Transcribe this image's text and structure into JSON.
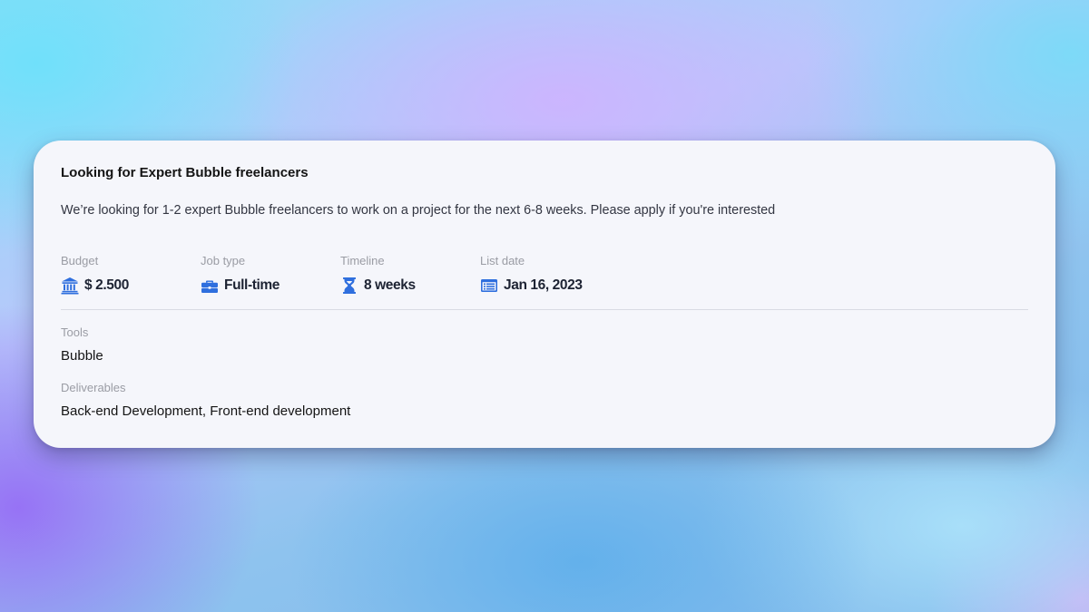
{
  "job": {
    "title": "Looking for Expert Bubble freelancers",
    "description": "We’re looking for 1-2 expert Bubble freelancers to work on a project for the next 6-8 weeks. Please apply if you're interested",
    "meta": {
      "budget": {
        "label": "Budget",
        "value": "$ 2.500",
        "icon": "bank-icon"
      },
      "job_type": {
        "label": "Job type",
        "value": "Full-time",
        "icon": "briefcase-icon"
      },
      "timeline": {
        "label": "Timeline",
        "value": "8 weeks",
        "icon": "hourglass-icon"
      },
      "list_date": {
        "label": "List date",
        "value": "Jan 16, 2023",
        "icon": "calendar-list-icon"
      }
    },
    "tools": {
      "label": "Tools",
      "value": "Bubble"
    },
    "deliverables": {
      "label": "Deliverables",
      "value": "Back-end Development, Front-end development"
    }
  },
  "colors": {
    "accent": "#2f6fde",
    "card_background": "#f5f6fb",
    "label_gray": "#9a9ca4",
    "value_dark": "#1d2333"
  }
}
